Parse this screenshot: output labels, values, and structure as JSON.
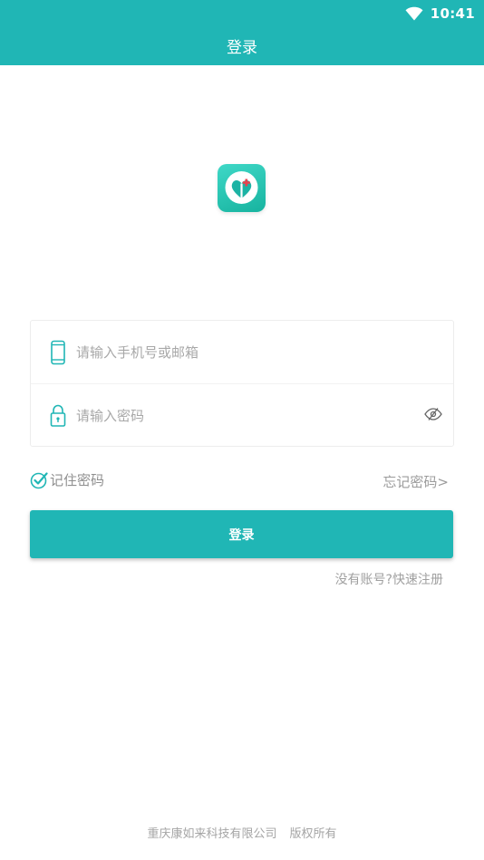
{
  "status_bar": {
    "time": "10:41",
    "icons": [
      "wifi-icon"
    ]
  },
  "header": {
    "title": "登录"
  },
  "logo": {
    "icon": "heart-plus-logo"
  },
  "form": {
    "account": {
      "icon": "phone-icon",
      "placeholder": "请输入手机号或邮箱",
      "value": ""
    },
    "password": {
      "icon": "lock-icon",
      "placeholder": "请输入密码",
      "value": "",
      "toggle_icon": "eye-hidden-icon"
    }
  },
  "options": {
    "remember_label": "记住密码",
    "remember_checked": true,
    "forgot_label": "忘记密码>"
  },
  "login_button": "登录",
  "register_link": "没有账号?快速注册",
  "footer": {
    "company": "重庆康如来科技有限公司",
    "rights": "版权所有"
  },
  "colors": {
    "primary": "#20b6b5",
    "placeholder": "#a8a8a8"
  }
}
